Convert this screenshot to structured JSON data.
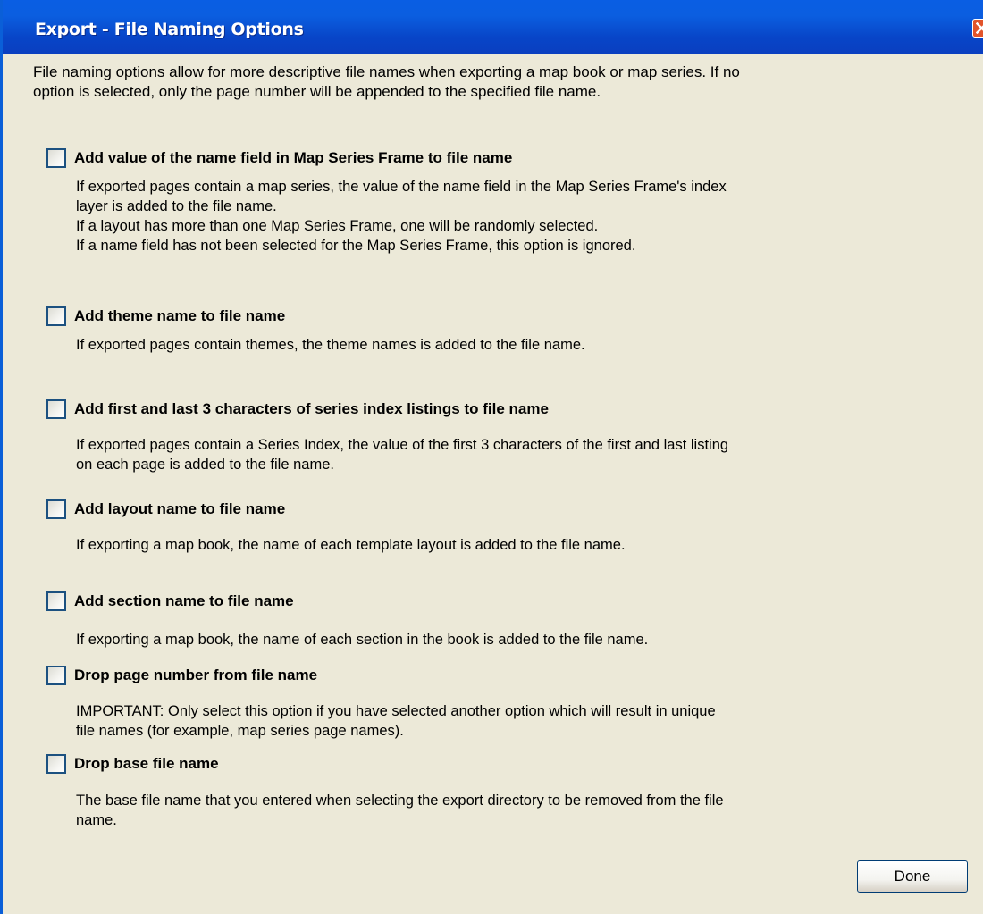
{
  "window": {
    "title": "Export - File Naming Options",
    "close_icon": "close-icon"
  },
  "intro": {
    "line1": "File naming options allow for more descriptive file names when exporting a map book or map series.  If no",
    "line2": "option is selected, only the page number will be appended to the specified file name."
  },
  "options": [
    {
      "label": "Add value of the name field in Map Series Frame to file name",
      "checked": false,
      "description": [
        "If exported pages contain a map series, the value of the name field in the Map Series Frame's index",
        "layer is added to the file name.",
        "If a layout has more than one Map Series Frame, one will be randomly selected.",
        "If a name field has not been selected for the Map Series Frame, this option is ignored."
      ]
    },
    {
      "label": "Add theme name to file name",
      "checked": false,
      "description": [
        "If exported pages contain themes, the theme names is added to the file name."
      ]
    },
    {
      "label": "Add first and last 3 characters of series index listings to file name",
      "checked": false,
      "description": [
        "If exported pages contain a Series Index, the value of the first 3 characters of the first and last listing",
        "on each page is added to the file name."
      ]
    },
    {
      "label": "Add layout name to file name",
      "checked": false,
      "description": [
        "If exporting a map book, the name of each template layout is added to the file name."
      ]
    },
    {
      "label": "Add section name to file name",
      "checked": false,
      "description": [
        "If exporting a map book, the name of each section in the book is added to the file name."
      ]
    },
    {
      "label": "Drop page number from file name",
      "checked": false,
      "description": [
        "IMPORTANT: Only select this option if you have selected another option which will result in unique",
        "file names (for example, map series page names)."
      ]
    },
    {
      "label": "Drop base file name",
      "checked": false,
      "description": [
        "The base file name that you entered when selecting the export directory to be removed from the file",
        "name."
      ]
    }
  ],
  "footer": {
    "done_label": "Done"
  },
  "colors": {
    "titlebar": "#0a5ee3",
    "window_bg": "#ece9d8",
    "close_button": "#e2542b",
    "checkbox_border": "#1c5180"
  }
}
